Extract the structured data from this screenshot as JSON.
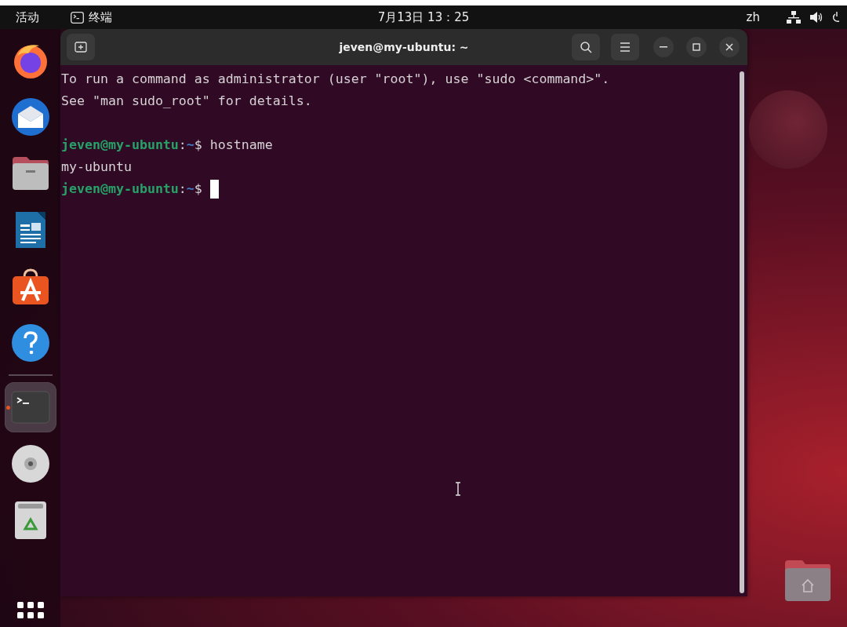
{
  "top_bar": {
    "activities": "活动",
    "app_name": "终端",
    "clock": "7月13日 13：25",
    "input_method": "zh"
  },
  "dock": {
    "items": [
      {
        "kind": "firefox",
        "selected": false,
        "running": false
      },
      {
        "kind": "thunderbird",
        "selected": false,
        "running": false
      },
      {
        "kind": "files",
        "selected": false,
        "running": false
      },
      {
        "kind": "writer",
        "selected": false,
        "running": false
      },
      {
        "kind": "software",
        "selected": false,
        "running": false
      },
      {
        "kind": "help",
        "selected": false,
        "running": false
      },
      {
        "kind": "separator"
      },
      {
        "kind": "terminal",
        "selected": true,
        "running": true
      },
      {
        "kind": "disc",
        "selected": false,
        "running": false
      },
      {
        "kind": "trash",
        "selected": false,
        "running": false
      }
    ]
  },
  "terminal": {
    "title": "jeven@my-ubuntu: ~",
    "lines": [
      {
        "kind": "text",
        "text": "To run a command as administrator (user \"root\"), use \"sudo <command>\"."
      },
      {
        "kind": "text",
        "text": "See \"man sudo_root\" for details."
      },
      {
        "kind": "blank"
      },
      {
        "kind": "prompt",
        "user": "jeven@my-ubuntu",
        "sep": ":",
        "path": "~",
        "symbol": "$",
        "command": "hostname"
      },
      {
        "kind": "text",
        "text": "my-ubuntu"
      },
      {
        "kind": "prompt",
        "user": "jeven@my-ubuntu",
        "sep": ":",
        "path": "~",
        "symbol": "$",
        "cursor": true
      }
    ]
  }
}
